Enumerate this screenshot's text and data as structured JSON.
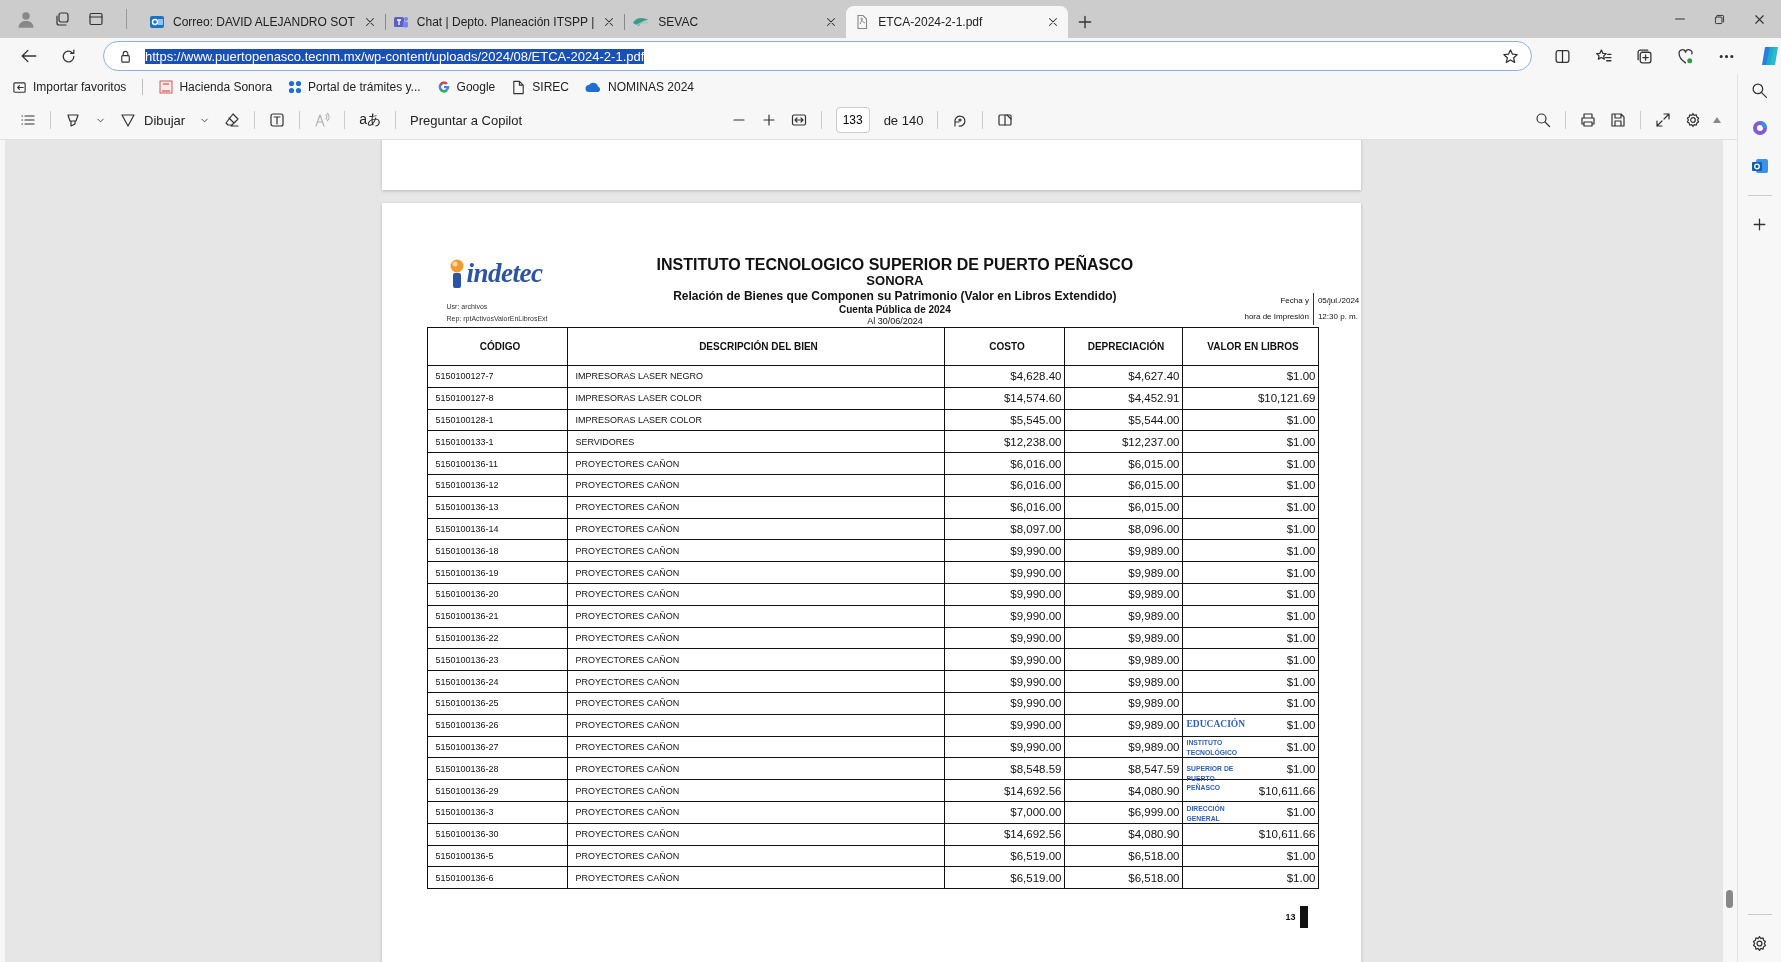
{
  "tabs": [
    {
      "kind": "mail",
      "title": "Correo: DAVID ALEJANDRO SOT",
      "selected": false
    },
    {
      "kind": "chat",
      "title": "Chat | Depto. Planeación ITSPP |",
      "selected": false
    },
    {
      "kind": "web",
      "title": "SEVAC",
      "selected": false
    },
    {
      "kind": "pdf",
      "title": "ETCA-2024-2-1.pdf",
      "selected": true
    }
  ],
  "address": {
    "url": "https://www.puertopenasco.tecnm.mx/wp-content/uploads/2024/08/ETCA-2024-2-1.pdf",
    "selected": true
  },
  "bookmarks": [
    {
      "kind": "import",
      "label": "Importar favoritos"
    },
    {
      "kind": "site",
      "label": "Hacienda Sonora"
    },
    {
      "kind": "apps",
      "label": "Portal de trámites y..."
    },
    {
      "kind": "google",
      "label": "Google"
    },
    {
      "kind": "page",
      "label": "SIREC"
    },
    {
      "kind": "cloud",
      "label": "NOMINAS 2024"
    }
  ],
  "pdf_toolbar": {
    "draw_label": "Dibujar",
    "translate_glyph": "aあ",
    "copilot_label": "Preguntar a Copilot",
    "page": "133",
    "page_total": "de 140"
  },
  "document": {
    "logo": "indetec",
    "user": "Usr: archivos",
    "report": "Rep: rptActivosValorEnLibrosExt",
    "institution": "INSTITUTO TECNOLOGICO SUPERIOR DE PUERTO PEÑASCO",
    "state": "SONORA",
    "report_title": "Relación de Bienes que Componen su Patrimonio (Valor en Libros Extendido)",
    "period": "Cuenta Pública de 2024",
    "as_of": "Al 30/06/2024",
    "date_label": "Fecha y",
    "date": "05/jul./2024",
    "time_label": "hora de Impresión",
    "time": "12:30 p. m.",
    "columns": [
      "CÓDIGO",
      "DESCRIPCIÓN DEL BIEN",
      "COSTO",
      "DEPRECIACIÓN",
      "VALOR EN LIBROS"
    ],
    "rows": [
      [
        "5150100127-7",
        "IMPRESORAS LASER NEGRO",
        "$4,628.40",
        "$4,627.40",
        "$1.00"
      ],
      [
        "5150100127-8",
        "IMPRESORAS LASER COLOR",
        "$14,574.60",
        "$4,452.91",
        "$10,121.69"
      ],
      [
        "5150100128-1",
        "IMPRESORAS LASER COLOR",
        "$5,545.00",
        "$5,544.00",
        "$1.00"
      ],
      [
        "5150100133-1",
        "SERVIDORES",
        "$12,238.00",
        "$12,237.00",
        "$1.00"
      ],
      [
        "5150100136-11",
        "PROYECTORES CAÑON",
        "$6,016.00",
        "$6,015.00",
        "$1.00"
      ],
      [
        "5150100136-12",
        "PROYECTORES CAÑON",
        "$6,016.00",
        "$6,015.00",
        "$1.00"
      ],
      [
        "5150100136-13",
        "PROYECTORES CAÑON",
        "$6,016.00",
        "$6,015.00",
        "$1.00"
      ],
      [
        "5150100136-14",
        "PROYECTORES CAÑON",
        "$8,097.00",
        "$8,096.00",
        "$1.00"
      ],
      [
        "5150100136-18",
        "PROYECTORES CAÑON",
        "$9,990.00",
        "$9,989.00",
        "$1.00"
      ],
      [
        "5150100136-19",
        "PROYECTORES CAÑON",
        "$9,990.00",
        "$9,989.00",
        "$1.00"
      ],
      [
        "5150100136-20",
        "PROYECTORES CAÑON",
        "$9,990.00",
        "$9,989.00",
        "$1.00"
      ],
      [
        "5150100136-21",
        "PROYECTORES CAÑON",
        "$9,990.00",
        "$9,989.00",
        "$1.00"
      ],
      [
        "5150100136-22",
        "PROYECTORES CAÑON",
        "$9,990.00",
        "$9,989.00",
        "$1.00"
      ],
      [
        "5150100136-23",
        "PROYECTORES CAÑON",
        "$9,990.00",
        "$9,989.00",
        "$1.00"
      ],
      [
        "5150100136-24",
        "PROYECTORES CAÑON",
        "$9,990.00",
        "$9,989.00",
        "$1.00"
      ],
      [
        "5150100136-25",
        "PROYECTORES CAÑON",
        "$9,990.00",
        "$9,989.00",
        "$1.00"
      ],
      [
        "5150100136-26",
        "PROYECTORES CAÑON",
        "$9,990.00",
        "$9,989.00",
        "$1.00"
      ],
      [
        "5150100136-27",
        "PROYECTORES CAÑON",
        "$9,990.00",
        "$9,989.00",
        "$1.00"
      ],
      [
        "5150100136-28",
        "PROYECTORES CAÑON",
        "$8,548.59",
        "$8,547.59",
        "$1.00"
      ],
      [
        "5150100136-29",
        "PROYECTORES CAÑON",
        "$14,692.56",
        "$4,080.90",
        "$10,611.66"
      ],
      [
        "5150100136-3",
        "PROYECTORES CAÑON",
        "$7,000.00",
        "$6,999.00",
        "$1.00"
      ],
      [
        "5150100136-30",
        "PROYECTORES CAÑON",
        "$14,692.56",
        "$4,080.90",
        "$10,611.66"
      ],
      [
        "5150100136-5",
        "PROYECTORES CAÑON",
        "$6,519.00",
        "$6,518.00",
        "$1.00"
      ],
      [
        "5150100136-6",
        "PROYECTORES CAÑON",
        "$6,519.00",
        "$6,518.00",
        "$1.00"
      ]
    ],
    "page_number": "13",
    "stamp": [
      "EDUCACIÓN",
      "INSTITUTO TECNOLÓGICO",
      "SUPERIOR DE PUERTO PEÑASCO",
      "DIRECCIÓN GENERAL"
    ]
  }
}
